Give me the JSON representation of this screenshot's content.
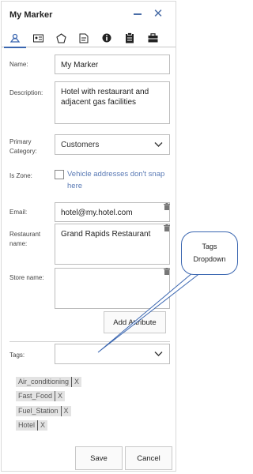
{
  "header": {
    "title": "My Marker"
  },
  "tabs": [
    {
      "icon": "marker-icon",
      "active": true
    },
    {
      "icon": "id-card-icon",
      "active": false
    },
    {
      "icon": "polygon-icon",
      "active": false
    },
    {
      "icon": "note-icon",
      "active": false
    },
    {
      "icon": "info-icon",
      "active": false
    },
    {
      "icon": "clipboard-icon",
      "active": false
    },
    {
      "icon": "briefcase-icon",
      "active": false
    }
  ],
  "form": {
    "name_label": "Name:",
    "name_value": "My Marker",
    "description_label": "Description:",
    "description_value": "Hotel with restaurant and adjacent gas facilities",
    "category_label_1": "Primary",
    "category_label_2": "Category:",
    "category_value": "Customers",
    "zone_label": "Is Zone:",
    "zone_text_1": "Vehicle addresses don't snap",
    "zone_text_2": "here",
    "email_label": "Email:",
    "email_value": "hotel@my.hotel.com",
    "restaurant_label_1": "Restaurant",
    "restaurant_label_2": "name:",
    "restaurant_value": "Grand Rapids Restaurant",
    "store_label": "Store name:",
    "store_value": "",
    "add_attribute_label": "Add Attribute",
    "tags_label": "Tags:",
    "tags_value": ""
  },
  "tags": [
    {
      "label": "Air_conditioning",
      "remove": "X"
    },
    {
      "label": "Fast_Food",
      "remove": "X"
    },
    {
      "label": "Fuel_Station",
      "remove": "X"
    },
    {
      "label": "Hotel",
      "remove": "X"
    }
  ],
  "footer": {
    "save_label": "Save",
    "cancel_label": "Cancel"
  },
  "callout": {
    "line1": "Tags",
    "line2": "Dropdown"
  },
  "colors": {
    "accent": "#3a66b0",
    "link": "#5a7ab5"
  }
}
